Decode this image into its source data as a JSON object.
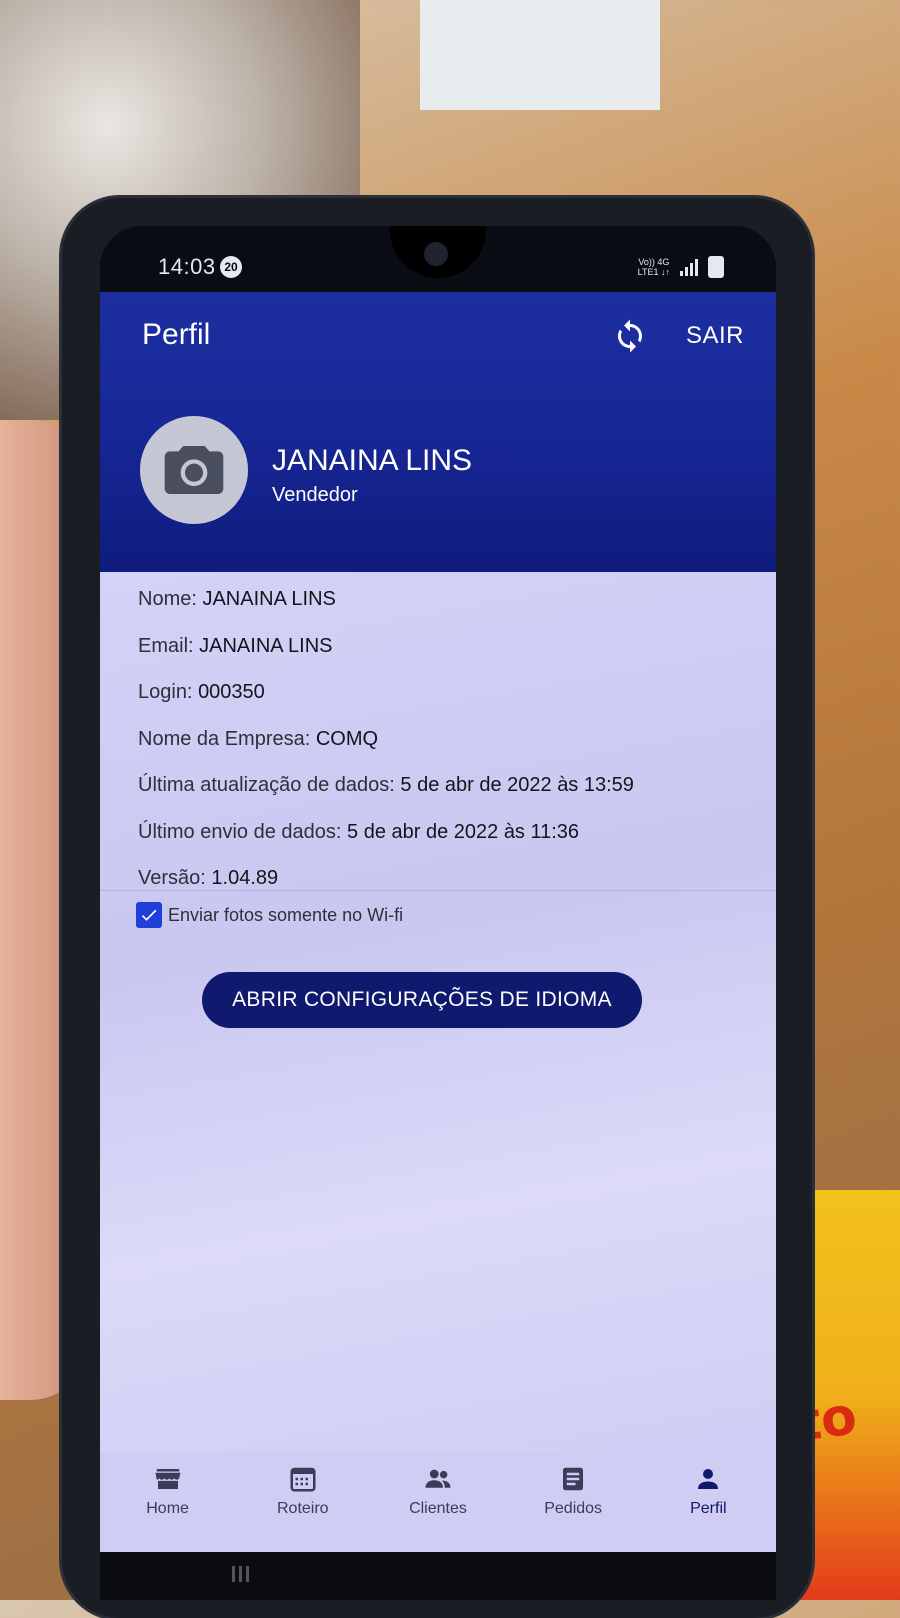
{
  "status_bar": {
    "time": "14:03",
    "notification_count": "20",
    "network_line1": "Vo)) 4G",
    "network_line2": "LTE1 ↓↑"
  },
  "header": {
    "title": "Perfil",
    "logout_label": "SAIR",
    "sync_icon": "sync-icon",
    "user_name": "JANAINA LINS",
    "user_role": "Vendedor",
    "avatar_icon": "camera-icon"
  },
  "profile": {
    "rows": [
      {
        "label": "Nome:",
        "value": "JANAINA LINS"
      },
      {
        "label": "Email:",
        "value": "JANAINA LINS"
      },
      {
        "label": "Login:",
        "value": "000350"
      },
      {
        "label": "Nome da Empresa:",
        "value": "COMQ"
      },
      {
        "label": "Última atualização de dados:",
        "value": "5 de abr de 2022 às 13:59"
      },
      {
        "label": "Último envio de dados:",
        "value": "5 de abr de 2022 às 11:36"
      },
      {
        "label": "Versão:",
        "value": "1.04.89"
      }
    ],
    "wifi_checkbox": {
      "label": "Enviar fotos somente no Wi-fi",
      "checked": true
    },
    "language_button": "ABRIR CONFIGURAÇÕES DE IDIOMA"
  },
  "bottom_nav": {
    "items": [
      {
        "label": "Home",
        "icon": "store-icon"
      },
      {
        "label": "Roteiro",
        "icon": "calendar-icon"
      },
      {
        "label": "Clientes",
        "icon": "people-icon"
      },
      {
        "label": "Pedidos",
        "icon": "list-icon"
      },
      {
        "label": "Perfil",
        "icon": "person-icon",
        "active": true
      }
    ]
  },
  "colors": {
    "header_blue": "#1a2b9a",
    "button_navy": "#0f1a6e",
    "checkbox_blue": "#1f3fd8",
    "content_lavender": "#d4d2f6"
  }
}
